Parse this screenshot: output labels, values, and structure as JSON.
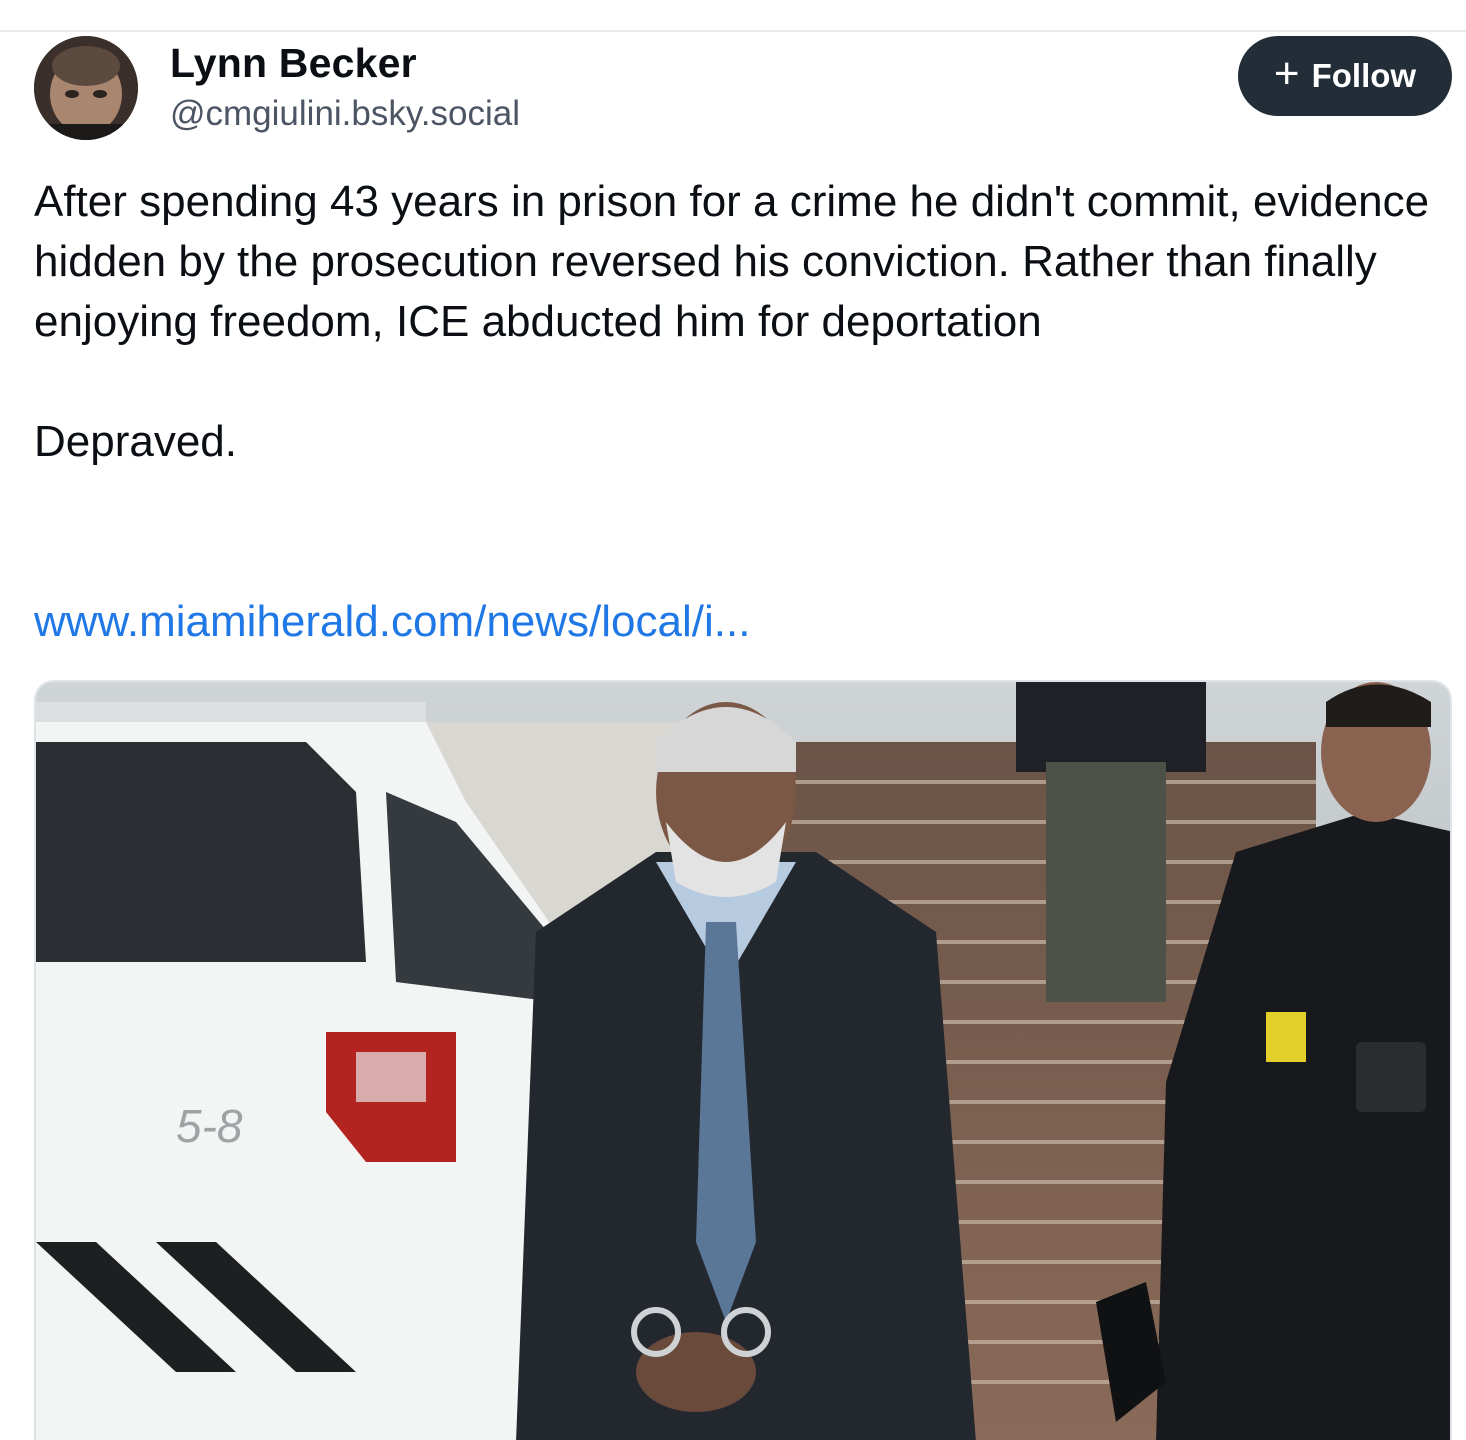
{
  "author": {
    "name": "Lynn Becker",
    "handle": "@cmgiulini.bsky.social",
    "avatar_icon": "profile-photo"
  },
  "follow_button": {
    "icon": "plus-icon",
    "label": "Follow"
  },
  "post": {
    "paragraphs": [
      "After spending 43 years in prison for a crime he didn't commit, evidence hidden by the prosecution reversed his conviction. Rather than finally enjoying freedom, ICE abducted him for deportation",
      "Depraved."
    ],
    "link_text": "www.miamiherald.com/news/local/i..."
  },
  "embed": {
    "image": "news-photo",
    "vehicle_label": "5-8"
  },
  "colors": {
    "follow_bg": "#232d38",
    "link": "#1f78e6",
    "handle": "#4b5563",
    "text": "#0b0f14"
  }
}
